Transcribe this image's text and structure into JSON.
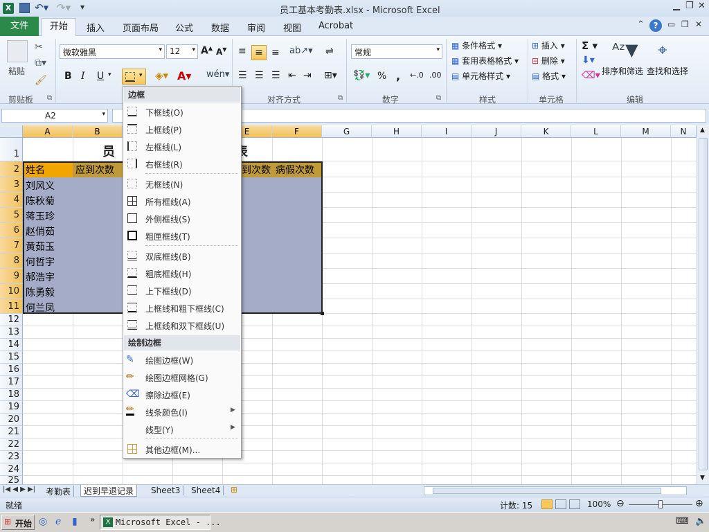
{
  "window": {
    "title": "员工基本考勤表.xlsx  -  Microsoft Excel"
  },
  "ribbon_tabs": [
    "文件",
    "开始",
    "插入",
    "页面布局",
    "公式",
    "数据",
    "审阅",
    "视图",
    "Acrobat"
  ],
  "ribbon": {
    "paste": "粘贴",
    "font_name": "微软雅黑",
    "font_size": "12",
    "bold": "B",
    "italic": "I",
    "underline": "U",
    "number_format": "常规",
    "percent": "%",
    "comma": ",",
    "conditional": "条件格式",
    "table_style": "套用表格格式",
    "cell_style": "单元格样式",
    "insert": "插入",
    "delete": "删除",
    "format": "格式",
    "sort_filter": "排序和筛选",
    "find_select": "查找和选择",
    "groups": {
      "clipboard": "剪贴板",
      "align": "对齐方式",
      "number": "数字",
      "styles": "样式",
      "cells": "单元格",
      "editing": "编辑"
    }
  },
  "formula_bar": {
    "name_box": "A2"
  },
  "sheet": {
    "columns": [
      "A",
      "B",
      "C",
      "D",
      "E",
      "F",
      "G",
      "H",
      "I",
      "J",
      "K",
      "L",
      "M",
      "N"
    ],
    "rows": [
      "1",
      "2",
      "3",
      "4",
      "5",
      "6",
      "7",
      "8",
      "9",
      "10",
      "11",
      "12",
      "13",
      "14",
      "15",
      "16",
      "17",
      "18",
      "19",
      "20",
      "21",
      "22",
      "23",
      "24",
      "25"
    ],
    "title_visible_left": "员",
    "title_visible_right": "表",
    "headers": {
      "A": "姓名",
      "B": "应到次数",
      "E": "到次数",
      "F": "病假次数"
    },
    "names": [
      "刘风义",
      "陈秋菊",
      "蒋玉珍",
      "赵俏茹",
      "黄茹玉",
      "何哲宇",
      "郝浩宇",
      "陈勇毅",
      "何兰凤"
    ]
  },
  "border_menu": {
    "section1": "边框",
    "items1": [
      "下框线(O)",
      "上框线(P)",
      "左框线(L)",
      "右框线(R)"
    ],
    "items2": [
      "无框线(N)",
      "所有框线(A)",
      "外侧框线(S)",
      "粗匣框线(T)"
    ],
    "items3": [
      "双底框线(B)",
      "粗底框线(H)",
      "上下框线(D)",
      "上框线和粗下框线(C)",
      "上框线和双下框线(U)"
    ],
    "section2": "绘制边框",
    "items4": [
      "绘图边框(W)",
      "绘图边框网格(G)",
      "擦除边框(E)",
      "线条颜色(I)",
      "线型(Y)"
    ],
    "more": "其他边框(M)..."
  },
  "sheet_tabs": [
    "考勤表",
    "迟到早退记录",
    "Sheet3",
    "Sheet4"
  ],
  "status": {
    "ready": "就绪",
    "count": "计数: 15",
    "zoom": "100%"
  },
  "taskbar": {
    "start": "开始",
    "excel_task": "Microsoft Excel - ..."
  },
  "colors": {
    "header_fill": "#c09a38",
    "selection_fill": "#a5acc8",
    "accent_green": "#217346"
  }
}
